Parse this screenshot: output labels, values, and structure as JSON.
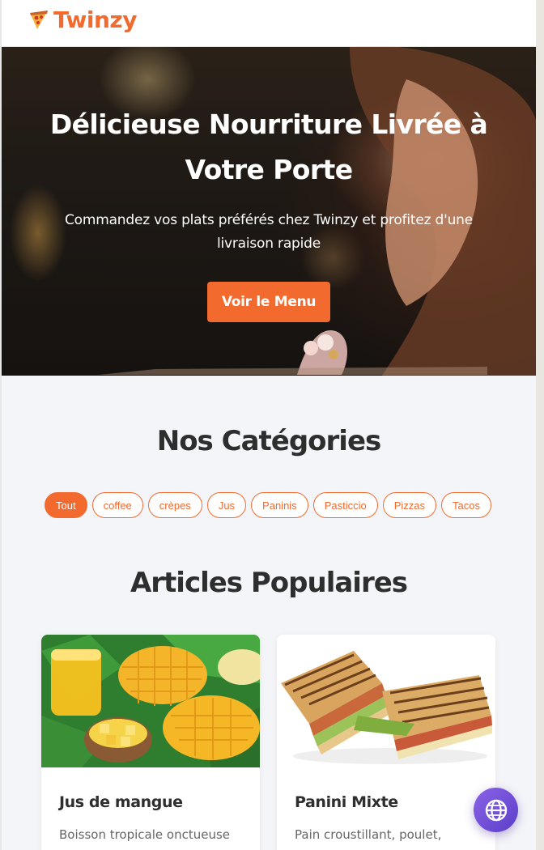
{
  "header": {
    "brand": "Twinzy",
    "logo_icon": "pizza-slice-icon"
  },
  "hero": {
    "title": "Délicieuse Nourriture Livrée à Votre Porte",
    "subtitle": "Commandez vos plats préférés chez Twinzy et profitez d'une livraison rapide",
    "cta_label": "Voir le Menu"
  },
  "categories": {
    "title": "Nos Catégories",
    "items": [
      "Tout",
      "coffee",
      "crèpes",
      "Jus",
      "Paninis",
      "Pasticcio",
      "Pizzas",
      "Tacos"
    ],
    "active": "Tout"
  },
  "popular": {
    "title": "Articles Populaires",
    "items": [
      {
        "name": "Jus de mangue",
        "description": "Boisson tropicale onctueuse",
        "image_icon": "mango-juice-image"
      },
      {
        "name": "Panini Mixte",
        "description": "Pain croustillant, poulet,",
        "image_icon": "panini-image"
      }
    ]
  },
  "fab": {
    "icon": "globe-icon"
  },
  "colors": {
    "accent": "#f26a2e",
    "text_dark": "#2e2e2e",
    "background": "#f4f5f8",
    "fab_purple": "#6a4bd6"
  }
}
